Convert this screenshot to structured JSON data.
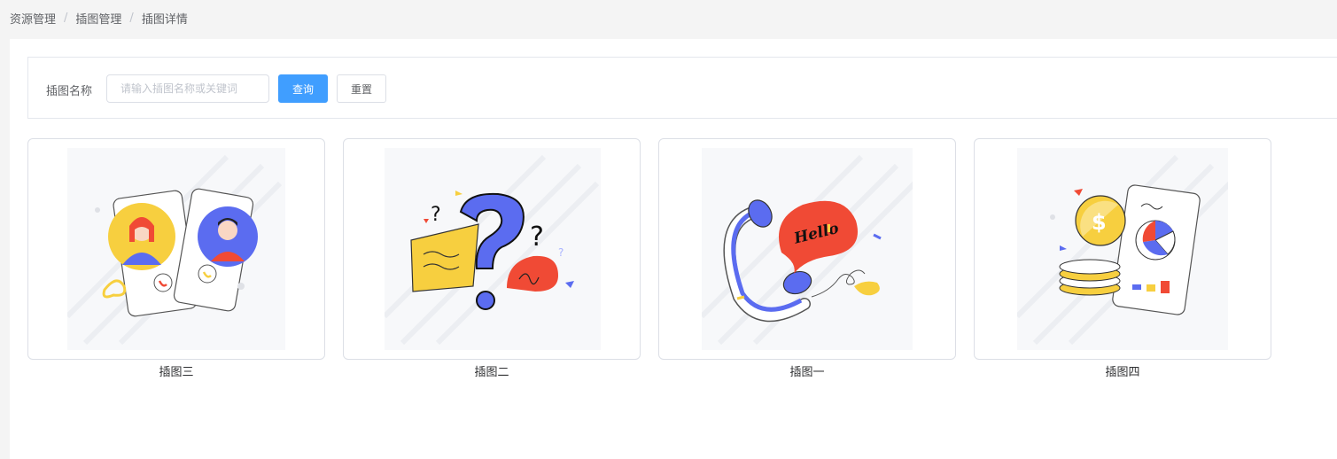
{
  "breadcrumb": {
    "items": [
      "资源管理",
      "插图管理",
      "插图详情"
    ],
    "separator": "/"
  },
  "search": {
    "label": "插图名称",
    "placeholder": "请输入插图名称或关键词",
    "value": "",
    "query_label": "查询",
    "reset_label": "重置"
  },
  "colors": {
    "primary": "#409eff",
    "blue": "#5b6cf0",
    "yellow": "#f7cf3f",
    "red": "#f04a35"
  },
  "cards": [
    {
      "caption": "插图三",
      "icon": "video-call-illustration"
    },
    {
      "caption": "插图二",
      "icon": "question-marks-illustration"
    },
    {
      "caption": "插图一",
      "icon": "hello-phone-illustration"
    },
    {
      "caption": "插图四",
      "icon": "finance-coins-illustration"
    }
  ]
}
